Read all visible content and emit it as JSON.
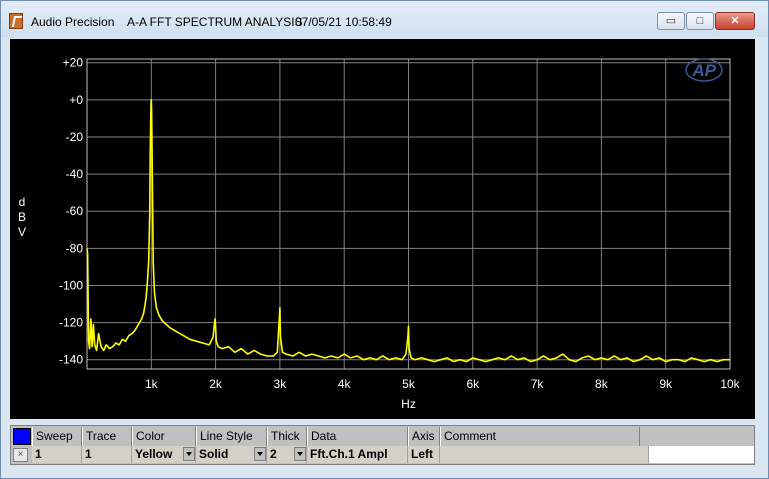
{
  "window": {
    "app_name": "Audio Precision",
    "graph_title": "A-A FFT SPECTRUM ANALYSIS",
    "datetime": "07/05/21 10:58:49",
    "minimize_glyph": "▭",
    "maximize_glyph": "□",
    "close_glyph": "✕"
  },
  "colors": {
    "trace": "#ffff00",
    "background": "#000000",
    "grid": "#808080",
    "legend_swatch": "#0000ff"
  },
  "chart_data": {
    "type": "line",
    "title": "A-A FFT SPECTRUM ANALYSIS",
    "xlabel": "Hz",
    "ylabel": "dBV",
    "ylabel_letters": [
      "d",
      "B",
      "V"
    ],
    "xlim": [
      0,
      10000
    ],
    "ylim": [
      -145,
      22
    ],
    "grid": true,
    "x_ticks": [
      1000,
      2000,
      3000,
      4000,
      5000,
      6000,
      7000,
      8000,
      9000,
      10000
    ],
    "x_tick_labels": [
      "1k",
      "2k",
      "3k",
      "4k",
      "5k",
      "6k",
      "7k",
      "8k",
      "9k",
      "10k"
    ],
    "y_ticks": [
      20,
      0,
      -20,
      -40,
      -60,
      -80,
      -100,
      -120,
      -140
    ],
    "y_tick_labels": [
      "+20",
      "+0",
      "-20",
      "-40",
      "-60",
      "-80",
      "-100",
      "-120",
      "-140"
    ],
    "logo": "AP",
    "series": [
      {
        "name": "Fft.Ch.1 Ampl",
        "x": [
          0,
          10,
          25,
          40,
          60,
          80,
          100,
          120,
          150,
          180,
          220,
          260,
          300,
          350,
          400,
          450,
          500,
          550,
          600,
          650,
          700,
          750,
          800,
          850,
          880,
          900,
          920,
          940,
          960,
          975,
          985,
          995,
          1000,
          1005,
          1015,
          1030,
          1050,
          1080,
          1120,
          1170,
          1230,
          1300,
          1400,
          1500,
          1600,
          1700,
          1800,
          1900,
          1960,
          1990,
          2000,
          2010,
          2040,
          2100,
          2200,
          2300,
          2400,
          2500,
          2600,
          2700,
          2800,
          2900,
          2960,
          2990,
          3000,
          3010,
          3040,
          3100,
          3200,
          3300,
          3400,
          3500,
          3600,
          3700,
          3800,
          3900,
          4000,
          4100,
          4200,
          4300,
          4400,
          4500,
          4600,
          4700,
          4800,
          4900,
          4960,
          4990,
          5000,
          5010,
          5040,
          5100,
          5200,
          5300,
          5400,
          5500,
          5600,
          5700,
          5800,
          5900,
          6000,
          6100,
          6200,
          6300,
          6400,
          6500,
          6600,
          6700,
          6800,
          6900,
          7000,
          7100,
          7200,
          7300,
          7400,
          7500,
          7600,
          7700,
          7800,
          7900,
          8000,
          8100,
          8200,
          8300,
          8400,
          8500,
          8600,
          8700,
          8800,
          8900,
          9000,
          9100,
          9200,
          9300,
          9400,
          9500,
          9600,
          9700,
          9800,
          9900,
          10000
        ],
        "y": [
          -80,
          -83,
          -130,
          -134,
          -118,
          -133,
          -121,
          -132,
          -135,
          -126,
          -133,
          -135,
          -132,
          -134,
          -133,
          -131,
          -132,
          -129,
          -130,
          -127,
          -126,
          -124,
          -121,
          -118,
          -115,
          -111,
          -106,
          -98,
          -87,
          -62,
          -25,
          -3,
          0,
          -5,
          -40,
          -88,
          -104,
          -112,
          -116,
          -119,
          -121,
          -123,
          -125,
          -127,
          -129,
          -130,
          -131,
          -132,
          -128,
          -118,
          -122,
          -130,
          -133,
          -134,
          -133,
          -136,
          -134,
          -137,
          -135,
          -137,
          -138,
          -138,
          -136,
          -118,
          -112,
          -128,
          -136,
          -137,
          -138,
          -136,
          -138,
          -137,
          -138,
          -139,
          -138,
          -139,
          -137,
          -139,
          -138,
          -140,
          -139,
          -140,
          -138,
          -140,
          -139,
          -140,
          -137,
          -128,
          -122,
          -134,
          -139,
          -140,
          -139,
          -140,
          -141,
          -140,
          -139,
          -141,
          -140,
          -141,
          -139,
          -140,
          -141,
          -140,
          -139,
          -140,
          -138,
          -140,
          -139,
          -141,
          -140,
          -138,
          -140,
          -139,
          -137,
          -140,
          -141,
          -139,
          -138,
          -140,
          -139,
          -140,
          -138,
          -140,
          -139,
          -141,
          -140,
          -138,
          -140,
          -139,
          -141,
          -140,
          -140,
          -141,
          -139,
          -140,
          -141,
          -140,
          -141,
          -140,
          -140
        ]
      }
    ]
  },
  "legend": {
    "headers": [
      "Sweep",
      "Trace",
      "Color",
      "Line Style",
      "Thick",
      "Data",
      "Axis",
      "Comment"
    ],
    "row": {
      "check": "×",
      "sweep": "1",
      "trace": "1",
      "color": "Yellow",
      "line_style": "Solid",
      "thick": "2",
      "data": "Fft.Ch.1 Ampl",
      "axis": "Left",
      "comment": ""
    }
  }
}
